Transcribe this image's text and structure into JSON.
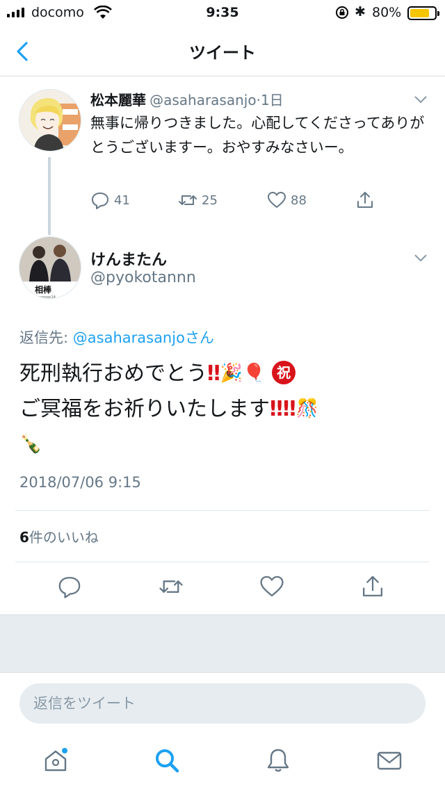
{
  "status_bar": {
    "carrier": "docomo",
    "time": "9:35",
    "battery_percent": "80%",
    "battery_level": 0.8,
    "battery_color": "#f5c500",
    "bluetooth_glyph": "✱"
  },
  "header": {
    "title": "ツイート",
    "back_icon": "chevron-left-icon"
  },
  "parent_tweet": {
    "name": "松本麗華",
    "handle": "@asaharasanjo",
    "separator": "·",
    "age": "1日",
    "text": "無事に帰りつきました。心配してくださってありがとうございますー。おやすみなさいー。",
    "replies": "41",
    "retweets": "25",
    "likes": "88"
  },
  "main_tweet": {
    "name": "けんまたん",
    "handle": "@pyokotannn",
    "avatar_caption": "相棒",
    "avatar_subcaption": "season14",
    "reply_to_prefix": "返信先: ",
    "reply_to_mention": "@asaharasanjo",
    "reply_to_suffix": "さん",
    "text_line1": "死刑執行おめでとう",
    "text_line2": "ご冥福をお祈りいたします",
    "emoji_double_exclamation": "‼",
    "emoji_party_popper": "🎉",
    "emoji_balloon": "🎈",
    "emoji_congratulations": "祝",
    "emoji_ribbon_gift": "🎊",
    "emoji_champagne": "🍾",
    "timestamp": "2018/07/06 9:15",
    "likes_count": "6",
    "likes_label": "件のいいね"
  },
  "reply_box": {
    "placeholder": "返信をツイート"
  },
  "colors": {
    "accent": "#1da1f2",
    "secondary_text": "#657786",
    "divider": "#e1e8ed",
    "background_gray": "#e6ecf0",
    "emoji_red": "#d8131b"
  },
  "tab_bar": {
    "items": [
      "home-icon",
      "search-icon",
      "notifications-icon",
      "messages-icon"
    ]
  }
}
